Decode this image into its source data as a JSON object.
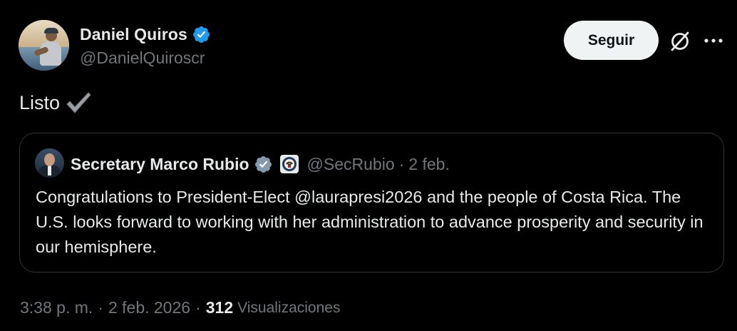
{
  "author": {
    "display_name": "Daniel Quiros",
    "handle": "@DanielQuiroscr",
    "verified": true
  },
  "actions": {
    "follow_label": "Seguir",
    "grok_icon": "grok-icon",
    "more_icon": "more-icon"
  },
  "tweet": {
    "text": "Listo",
    "emoji": "check-mark-icon"
  },
  "quote": {
    "display_name": "Secretary Marco Rubio",
    "handle": "@SecRubio",
    "separator": "·",
    "date": "2 feb.",
    "verified_color": "#829aab",
    "affiliation_icon": "us-state-department-seal-icon",
    "text": "Congratulations to President-Elect @laurapresi2026 and the people of Costa Rica. The U.S. looks forward to working with her administration to advance prosperity and security in our hemisphere."
  },
  "meta": {
    "time": "3:38 p. m.",
    "separator": "·",
    "date": "2 feb. 2026",
    "views_count": "312",
    "views_label": "Visualizaciones"
  },
  "colors": {
    "background": "#000000",
    "primary_text": "#e7e9ea",
    "secondary_text": "#71767b",
    "verified_blue": "#1d9bf0",
    "border": "#2f3336",
    "button_bg": "#eff3f4"
  }
}
